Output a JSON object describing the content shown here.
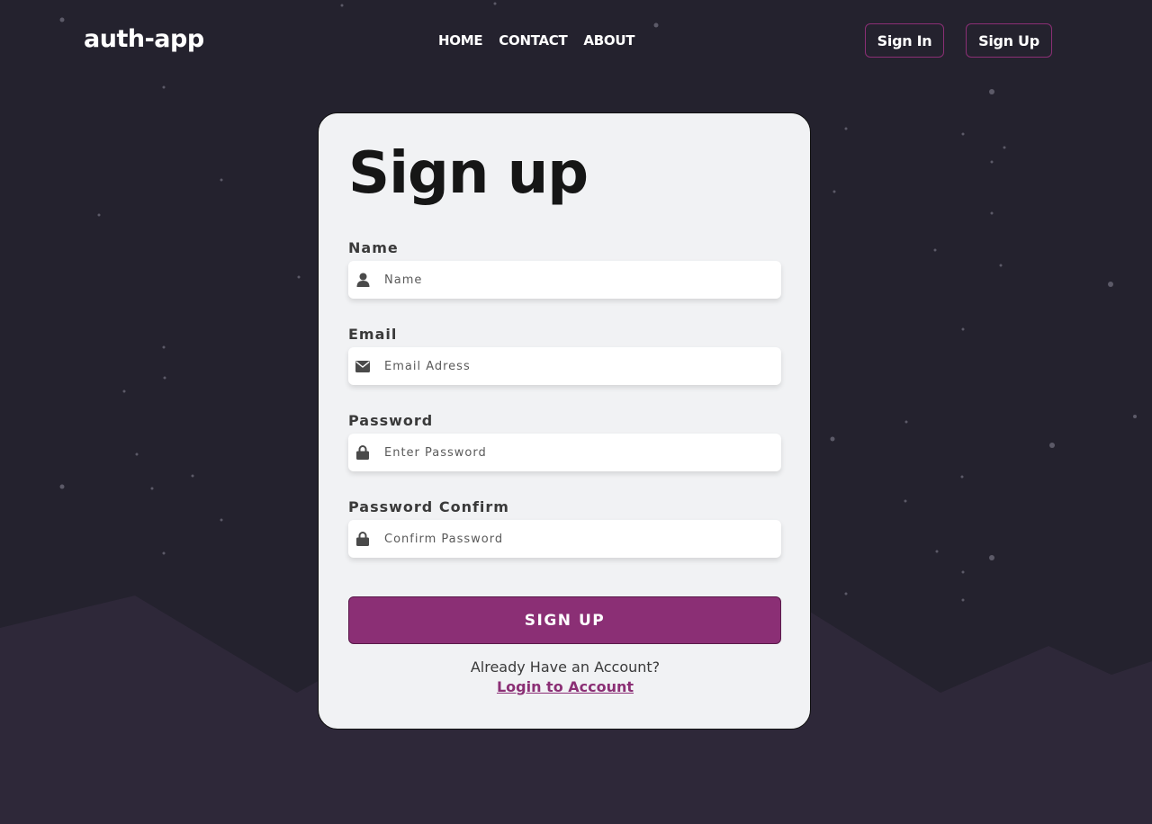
{
  "colors": {
    "background": "#24222e",
    "mountains_back": "#1e1c26",
    "mountains_front": "#2e2839",
    "accent": "#8b2f75",
    "card": "#f1f2f4"
  },
  "nav": {
    "logo": "auth-app",
    "links": [
      "HOME",
      "CONTACT",
      "ABOUT"
    ],
    "sign_in": "Sign In",
    "sign_up": "Sign Up"
  },
  "form": {
    "title": "Sign up",
    "fields": [
      {
        "label": "Name",
        "placeholder": "Name",
        "icon": "user-icon"
      },
      {
        "label": "Email",
        "placeholder": "Email Adress",
        "icon": "envelope-icon"
      },
      {
        "label": "Password",
        "placeholder": "Enter Password",
        "icon": "lock-icon"
      },
      {
        "label": "Password Confirm",
        "placeholder": "Confirm Password",
        "icon": "lock-icon"
      }
    ],
    "submit_label": "SIGN UP",
    "already_text": "Already Have an Account?",
    "login_link": "Login to Account"
  }
}
